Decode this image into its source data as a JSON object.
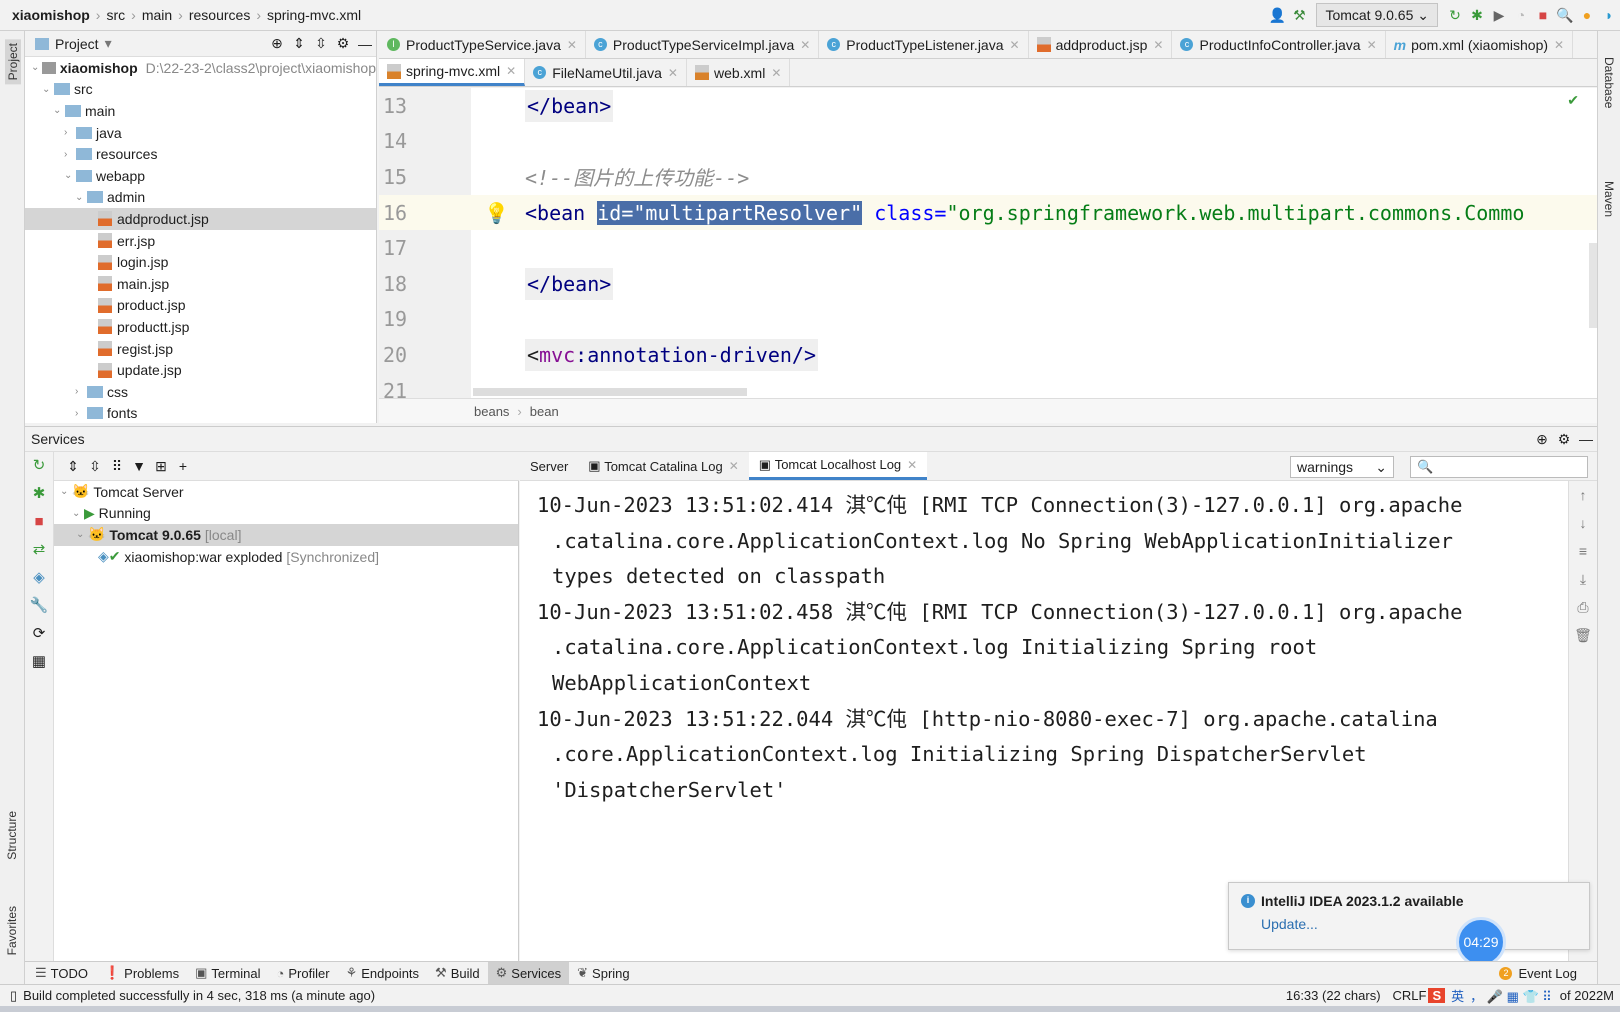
{
  "breadcrumb": [
    "xiaomishop",
    "src",
    "main",
    "resources",
    "spring-mvc.xml"
  ],
  "toolbar": {
    "run_config": "Tomcat 9.0.65"
  },
  "left_strip": [
    "Project",
    "Structure",
    "Favorites"
  ],
  "right_strip": [
    "Database",
    "Maven"
  ],
  "project": {
    "title": "Project",
    "root": "xiaomishop",
    "root_path": "D:\\22-23-2\\class2\\project\\xiaomishop",
    "items": [
      {
        "label": "src",
        "depth": 1,
        "type": "folder"
      },
      {
        "label": "main",
        "depth": 2,
        "type": "folder"
      },
      {
        "label": "java",
        "depth": 3,
        "type": "folder"
      },
      {
        "label": "resources",
        "depth": 3,
        "type": "folder"
      },
      {
        "label": "webapp",
        "depth": 3,
        "type": "folder"
      },
      {
        "label": "admin",
        "depth": 4,
        "type": "folder"
      },
      {
        "label": "addproduct.jsp",
        "depth": 5,
        "type": "jsp",
        "selected": true
      },
      {
        "label": "err.jsp",
        "depth": 5,
        "type": "jsp"
      },
      {
        "label": "login.jsp",
        "depth": 5,
        "type": "jsp"
      },
      {
        "label": "main.jsp",
        "depth": 5,
        "type": "jsp"
      },
      {
        "label": "product.jsp",
        "depth": 5,
        "type": "jsp"
      },
      {
        "label": "productt.jsp",
        "depth": 5,
        "type": "jsp"
      },
      {
        "label": "regist.jsp",
        "depth": 5,
        "type": "jsp"
      },
      {
        "label": "update.jsp",
        "depth": 5,
        "type": "jsp"
      },
      {
        "label": "css",
        "depth": 4,
        "type": "folder"
      },
      {
        "label": "fonts",
        "depth": 4,
        "type": "folder"
      }
    ]
  },
  "tabs_row1": [
    {
      "label": "ProductTypeService.java",
      "icon": "I"
    },
    {
      "label": "ProductTypeServiceImpl.java",
      "icon": "C"
    },
    {
      "label": "ProductTypeListener.java",
      "icon": "C"
    },
    {
      "label": "addproduct.jsp",
      "icon": "jsp"
    },
    {
      "label": "ProductInfoController.java",
      "icon": "C"
    },
    {
      "label": "pom.xml (xiaomishop)",
      "icon": "m"
    }
  ],
  "tabs_row2": [
    {
      "label": "spring-mvc.xml",
      "icon": "xml",
      "active": true
    },
    {
      "label": "FileNameUtil.java",
      "icon": "C"
    },
    {
      "label": "web.xml",
      "icon": "xml"
    }
  ],
  "editor": {
    "line_numbers": [
      "13",
      "14",
      "15",
      "16",
      "17",
      "18",
      "19",
      "20",
      "21"
    ],
    "line13": "</bean>",
    "comment": "<!--图片的上传功能-->",
    "l16_tag": "<bean ",
    "l16_id": "id=\"multipartResolver\"",
    "l16_class_attr": "class=",
    "l16_class_val": "\"org.springframework.web.multipart.commons.Commo",
    "line18": "</bean>",
    "l20_pre": "<",
    "l20_ns": "mvc",
    "l20_rest": ":annotation-driven/>",
    "breadcrumb": [
      "beans",
      "bean"
    ]
  },
  "services": {
    "title": "Services",
    "tree": [
      {
        "label": "Tomcat Server"
      },
      {
        "label": "Running"
      },
      {
        "label": "Tomcat 9.0.65",
        "suffix": "[local]"
      },
      {
        "label": "xiaomishop:war exploded",
        "suffix": "[Synchronized]"
      }
    ],
    "log_tabs": [
      "Server",
      "Tomcat Catalina Log",
      "Tomcat Localhost Log"
    ],
    "filter": "warnings",
    "log": [
      [
        "10-Jun-2023 13:51:02.414 淇℃伅 [RMI TCP Connection(3)-127.0.0.1] org.apache",
        ".catalina.core.ApplicationContext.log No Spring WebApplicationInitializer",
        "types detected on classpath"
      ],
      [
        "10-Jun-2023 13:51:02.458 淇℃伅 [RMI TCP Connection(3)-127.0.0.1] org.apache",
        ".catalina.core.ApplicationContext.log Initializing Spring root",
        "WebApplicationContext"
      ],
      [
        "10-Jun-2023 13:51:22.044 淇℃伅 [http-nio-8080-exec-7] org.apache.catalina",
        ".core.ApplicationContext.log Initializing Spring DispatcherServlet",
        "'DispatcherServlet'"
      ]
    ]
  },
  "bottom_tabs": [
    "TODO",
    "Problems",
    "Terminal",
    "Profiler",
    "Endpoints",
    "Build",
    "Services",
    "Spring"
  ],
  "event_log": {
    "count": "2",
    "label": "Event Log"
  },
  "status": {
    "message": "Build completed successfully in 4 sec, 318 ms (a minute ago)",
    "position": "16:33 (22 chars)",
    "line_sep": "CRLF",
    "memory": "of 2022M",
    "ime": "英"
  },
  "notification": {
    "title": "IntelliJ IDEA 2023.1.2 available",
    "link": "Update..."
  },
  "timer": "04:29"
}
